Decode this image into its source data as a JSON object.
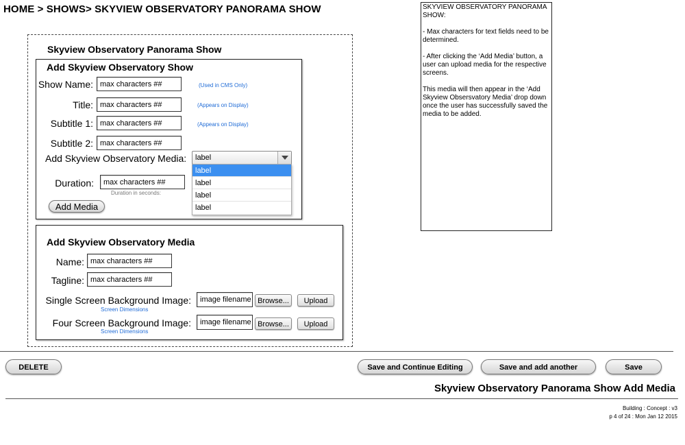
{
  "breadcrumb": "HOME > SHOWS> SKYVIEW OBSERVATORY PANORAMA SHOW",
  "outer_title": "Skyview Observatory Panorama Show",
  "show_panel": {
    "title": "Add Skyview Observatory Show",
    "fields": [
      {
        "label": "Show Name:",
        "value": "max characters ##",
        "hint": "(Used in CMS Only)"
      },
      {
        "label": "Title:",
        "value": "max characters ##",
        "hint": "(Appears on Display)"
      },
      {
        "label": "Subtitle 1:",
        "value": "max characters ##",
        "hint": "(Appears on Display)"
      },
      {
        "label": "Subtitle 2:",
        "value": "max characters ##",
        "hint": ""
      }
    ],
    "media_label": "Add Skyview Observatory Media:",
    "media_select": {
      "selected": "label",
      "options": [
        "label",
        "label",
        "label",
        "label"
      ],
      "highlighted_index": 0
    },
    "duration": {
      "label": "Duration:",
      "value": "max characters ##",
      "hint": "Duration in seconds:"
    },
    "add_media_button": "Add Media"
  },
  "media_panel": {
    "title": "Add Skyview Observatory Media",
    "name": {
      "label": "Name:",
      "value": "max characters ##"
    },
    "tagline": {
      "label": "Tagline:",
      "value": "max characters ##"
    },
    "single_bg": {
      "label": "Single Screen Background Image:",
      "value": "image filename",
      "hint": "Screen Dimensions",
      "browse": "Browse...",
      "upload": "Upload"
    },
    "four_bg": {
      "label": "Four Screen Background Image:",
      "value": "image filename",
      "hint": "Screen Dimensions",
      "browse": "Browse...",
      "upload": "Upload"
    }
  },
  "notes": {
    "heading": "SKYVIEW OBSERVATORY PANORAMA SHOW:",
    "items": [
      "-  Max characters for text fields need to be determined.",
      "- After clicking the ‘Add Media’ button, a user can upload media for the respective screens.",
      "This media will then appear in the ‘Add Skyview Obsersvatory Media’ drop down once the user has successfully saved the media to be added."
    ]
  },
  "actions": {
    "delete": "DELETE",
    "save_continue": "Save and Continue Editing",
    "save_add": "Save and add another",
    "save": "Save"
  },
  "footer": {
    "page_title": "Skyview Observatory Panorama Show Add Media",
    "meta_line1": "Building : Concept : v3",
    "meta_line2": "p 4 of 24 : Mon Jan 12 2015"
  },
  "colors": {
    "hint_blue": "#1f6bd6",
    "highlight": "#3b8ff0"
  }
}
